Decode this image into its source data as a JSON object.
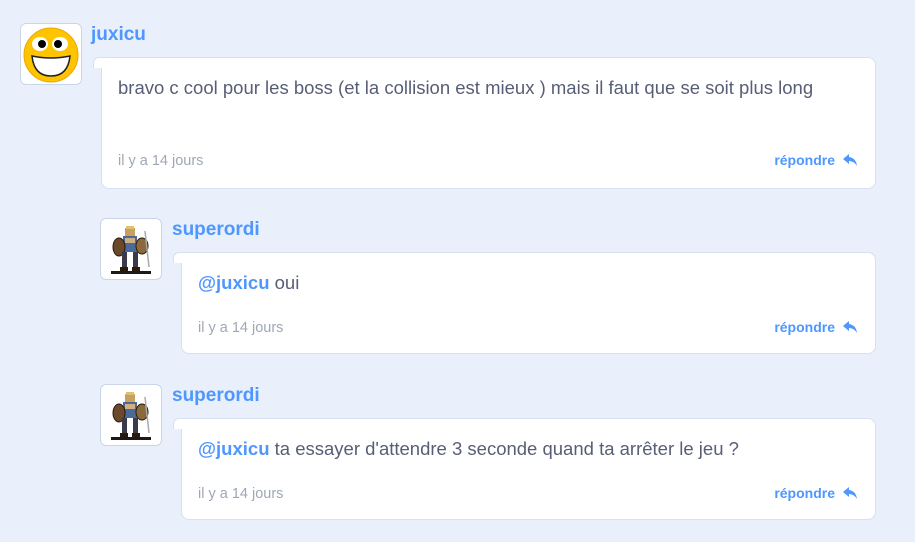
{
  "comments": [
    {
      "username": "juxicu",
      "avatar": "smiley-face-icon",
      "mention": "",
      "text": "bravo c cool pour les boss (et la collision est mieux ) mais il faut que se soit plus long",
      "time": "il y a 14 jours",
      "reply_label": "répondre"
    },
    {
      "username": "superordi",
      "avatar": "pixel-warrior-icon",
      "mention": "@juxicu",
      "text": " oui",
      "time": "il y a 14 jours",
      "reply_label": "répondre"
    },
    {
      "username": "superordi",
      "avatar": "pixel-warrior-icon",
      "mention": "@juxicu",
      "text": " ta essayer d'attendre 3 seconde quand ta arrêter le jeu ?",
      "time": "il y a 14 jours",
      "reply_label": "répondre"
    }
  ],
  "colors": {
    "background": "#e9f0fb",
    "accent": "#4d97ff",
    "text": "#575e75",
    "muted": "#9fa7b7"
  }
}
